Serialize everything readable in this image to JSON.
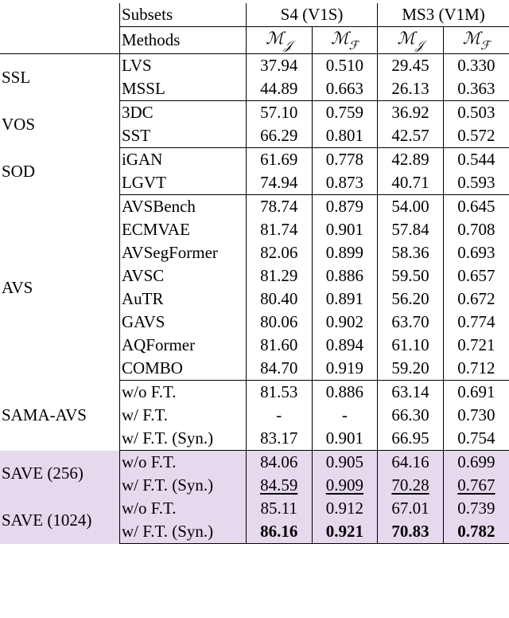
{
  "header": {
    "subsets_label": "Subsets",
    "methods_label": "Methods",
    "s4_label": "S4 (V1S)",
    "ms3_label": "MS3 (V1M)",
    "metric_j_html": "ℳ<span class='sub'>𝒥</span>",
    "metric_f_html": "ℳ<span class='sub'>ℱ</span>"
  },
  "groups": [
    {
      "category": "SSL",
      "highlight": false,
      "rows": [
        {
          "method": "LVS",
          "s4_mj": "37.94",
          "s4_mf": "0.510",
          "ms3_mj": "29.45",
          "ms3_mf": "0.330"
        },
        {
          "method": "MSSL",
          "s4_mj": "44.89",
          "s4_mf": "0.663",
          "ms3_mj": "26.13",
          "ms3_mf": "0.363"
        }
      ]
    },
    {
      "category": "VOS",
      "highlight": false,
      "rows": [
        {
          "method": "3DC",
          "s4_mj": "57.10",
          "s4_mf": "0.759",
          "ms3_mj": "36.92",
          "ms3_mf": "0.503"
        },
        {
          "method": "SST",
          "s4_mj": "66.29",
          "s4_mf": "0.801",
          "ms3_mj": "42.57",
          "ms3_mf": "0.572"
        }
      ]
    },
    {
      "category": "SOD",
      "highlight": false,
      "rows": [
        {
          "method": "iGAN",
          "s4_mj": "61.69",
          "s4_mf": "0.778",
          "ms3_mj": "42.89",
          "ms3_mf": "0.544"
        },
        {
          "method": "LGVT",
          "s4_mj": "74.94",
          "s4_mf": "0.873",
          "ms3_mj": "40.71",
          "ms3_mf": "0.593"
        }
      ]
    },
    {
      "category": "AVS",
      "highlight": false,
      "rows": [
        {
          "method": "AVSBench",
          "s4_mj": "78.74",
          "s4_mf": "0.879",
          "ms3_mj": "54.00",
          "ms3_mf": "0.645"
        },
        {
          "method": "ECMVAE",
          "s4_mj": "81.74",
          "s4_mf": "0.901",
          "ms3_mj": "57.84",
          "ms3_mf": "0.708"
        },
        {
          "method": "AVSegFormer",
          "s4_mj": "82.06",
          "s4_mf": "0.899",
          "ms3_mj": "58.36",
          "ms3_mf": "0.693"
        },
        {
          "method": "AVSC",
          "s4_mj": "81.29",
          "s4_mf": "0.886",
          "ms3_mj": "59.50",
          "ms3_mf": "0.657"
        },
        {
          "method": "AuTR",
          "s4_mj": "80.40",
          "s4_mf": "0.891",
          "ms3_mj": "56.20",
          "ms3_mf": "0.672"
        },
        {
          "method": "GAVS",
          "s4_mj": "80.06",
          "s4_mf": "0.902",
          "ms3_mj": "63.70",
          "ms3_mf": "0.774"
        },
        {
          "method": "AQFormer",
          "s4_mj": "81.60",
          "s4_mf": "0.894",
          "ms3_mj": "61.10",
          "ms3_mf": "0.721"
        },
        {
          "method": "COMBO",
          "s4_mj": "84.70",
          "s4_mf": "0.919",
          "ms3_mj": "59.20",
          "ms3_mf": "0.712"
        }
      ]
    },
    {
      "category": "SAMA-AVS",
      "highlight": false,
      "rows": [
        {
          "method": "w/o F.T.",
          "s4_mj": "81.53",
          "s4_mf": "0.886",
          "ms3_mj": "63.14",
          "ms3_mf": "0.691"
        },
        {
          "method": "w/ F.T.",
          "s4_mj": "-",
          "s4_mf": "-",
          "ms3_mj": "66.30",
          "ms3_mf": "0.730"
        },
        {
          "method": "w/ F.T. (Syn.)",
          "s4_mj": "83.17",
          "s4_mf": "0.901",
          "ms3_mj": "66.95",
          "ms3_mf": "0.754"
        }
      ]
    },
    {
      "category": "SAVE (256)",
      "highlight": true,
      "rows": [
        {
          "method": "w/o F.T.",
          "s4_mj": "84.06",
          "s4_mf": "0.905",
          "ms3_mj": "64.16",
          "ms3_mf": "0.699"
        },
        {
          "method": "w/ F.T. (Syn.)",
          "s4_mj": "84.59",
          "s4_mj_style": "under",
          "s4_mf": "0.909",
          "s4_mf_style": "under",
          "ms3_mj": "70.28",
          "ms3_mj_style": "under",
          "ms3_mf": "0.767",
          "ms3_mf_style": "under"
        }
      ],
      "continue_with_next": true
    },
    {
      "category": "SAVE (1024)",
      "highlight": true,
      "rows": [
        {
          "method": "w/o F.T.",
          "s4_mj": "85.11",
          "s4_mf": "0.912",
          "ms3_mj": "67.01",
          "ms3_mf": "0.739"
        },
        {
          "method": "w/ F.T. (Syn.)",
          "s4_mj": "86.16",
          "s4_mj_style": "bold",
          "s4_mf": "0.921",
          "s4_mf_style": "bold",
          "ms3_mj": "70.83",
          "ms3_mj_style": "bold",
          "ms3_mf": "0.782",
          "ms3_mf_style": "bold"
        }
      ]
    }
  ],
  "chart_data": {
    "type": "table",
    "title": "",
    "column_groups": [
      "S4 (V1S)",
      "MS3 (V1M)"
    ],
    "metric_columns": [
      "M_J",
      "M_F",
      "M_J",
      "M_F"
    ],
    "rows": [
      {
        "category": "SSL",
        "method": "LVS",
        "values": [
          37.94,
          0.51,
          29.45,
          0.33
        ]
      },
      {
        "category": "SSL",
        "method": "MSSL",
        "values": [
          44.89,
          0.663,
          26.13,
          0.363
        ]
      },
      {
        "category": "VOS",
        "method": "3DC",
        "values": [
          57.1,
          0.759,
          36.92,
          0.503
        ]
      },
      {
        "category": "VOS",
        "method": "SST",
        "values": [
          66.29,
          0.801,
          42.57,
          0.572
        ]
      },
      {
        "category": "SOD",
        "method": "iGAN",
        "values": [
          61.69,
          0.778,
          42.89,
          0.544
        ]
      },
      {
        "category": "SOD",
        "method": "LGVT",
        "values": [
          74.94,
          0.873,
          40.71,
          0.593
        ]
      },
      {
        "category": "AVS",
        "method": "AVSBench",
        "values": [
          78.74,
          0.879,
          54.0,
          0.645
        ]
      },
      {
        "category": "AVS",
        "method": "ECMVAE",
        "values": [
          81.74,
          0.901,
          57.84,
          0.708
        ]
      },
      {
        "category": "AVS",
        "method": "AVSegFormer",
        "values": [
          82.06,
          0.899,
          58.36,
          0.693
        ]
      },
      {
        "category": "AVS",
        "method": "AVSC",
        "values": [
          81.29,
          0.886,
          59.5,
          0.657
        ]
      },
      {
        "category": "AVS",
        "method": "AuTR",
        "values": [
          80.4,
          0.891,
          56.2,
          0.672
        ]
      },
      {
        "category": "AVS",
        "method": "GAVS",
        "values": [
          80.06,
          0.902,
          63.7,
          0.774
        ]
      },
      {
        "category": "AVS",
        "method": "AQFormer",
        "values": [
          81.6,
          0.894,
          61.1,
          0.721
        ]
      },
      {
        "category": "AVS",
        "method": "COMBO",
        "values": [
          84.7,
          0.919,
          59.2,
          0.712
        ]
      },
      {
        "category": "SAMA-AVS",
        "method": "w/o F.T.",
        "values": [
          81.53,
          0.886,
          63.14,
          0.691
        ]
      },
      {
        "category": "SAMA-AVS",
        "method": "w/ F.T.",
        "values": [
          null,
          null,
          66.3,
          0.73
        ]
      },
      {
        "category": "SAMA-AVS",
        "method": "w/ F.T. (Syn.)",
        "values": [
          83.17,
          0.901,
          66.95,
          0.754
        ]
      },
      {
        "category": "SAVE (256)",
        "method": "w/o F.T.",
        "values": [
          84.06,
          0.905,
          64.16,
          0.699
        ]
      },
      {
        "category": "SAVE (256)",
        "method": "w/ F.T. (Syn.)",
        "values": [
          84.59,
          0.909,
          70.28,
          0.767
        ],
        "mark": "underline"
      },
      {
        "category": "SAVE (1024)",
        "method": "w/o F.T.",
        "values": [
          85.11,
          0.912,
          67.01,
          0.739
        ]
      },
      {
        "category": "SAVE (1024)",
        "method": "w/ F.T. (Syn.)",
        "values": [
          86.16,
          0.921,
          70.83,
          0.782
        ],
        "mark": "bold"
      }
    ]
  }
}
